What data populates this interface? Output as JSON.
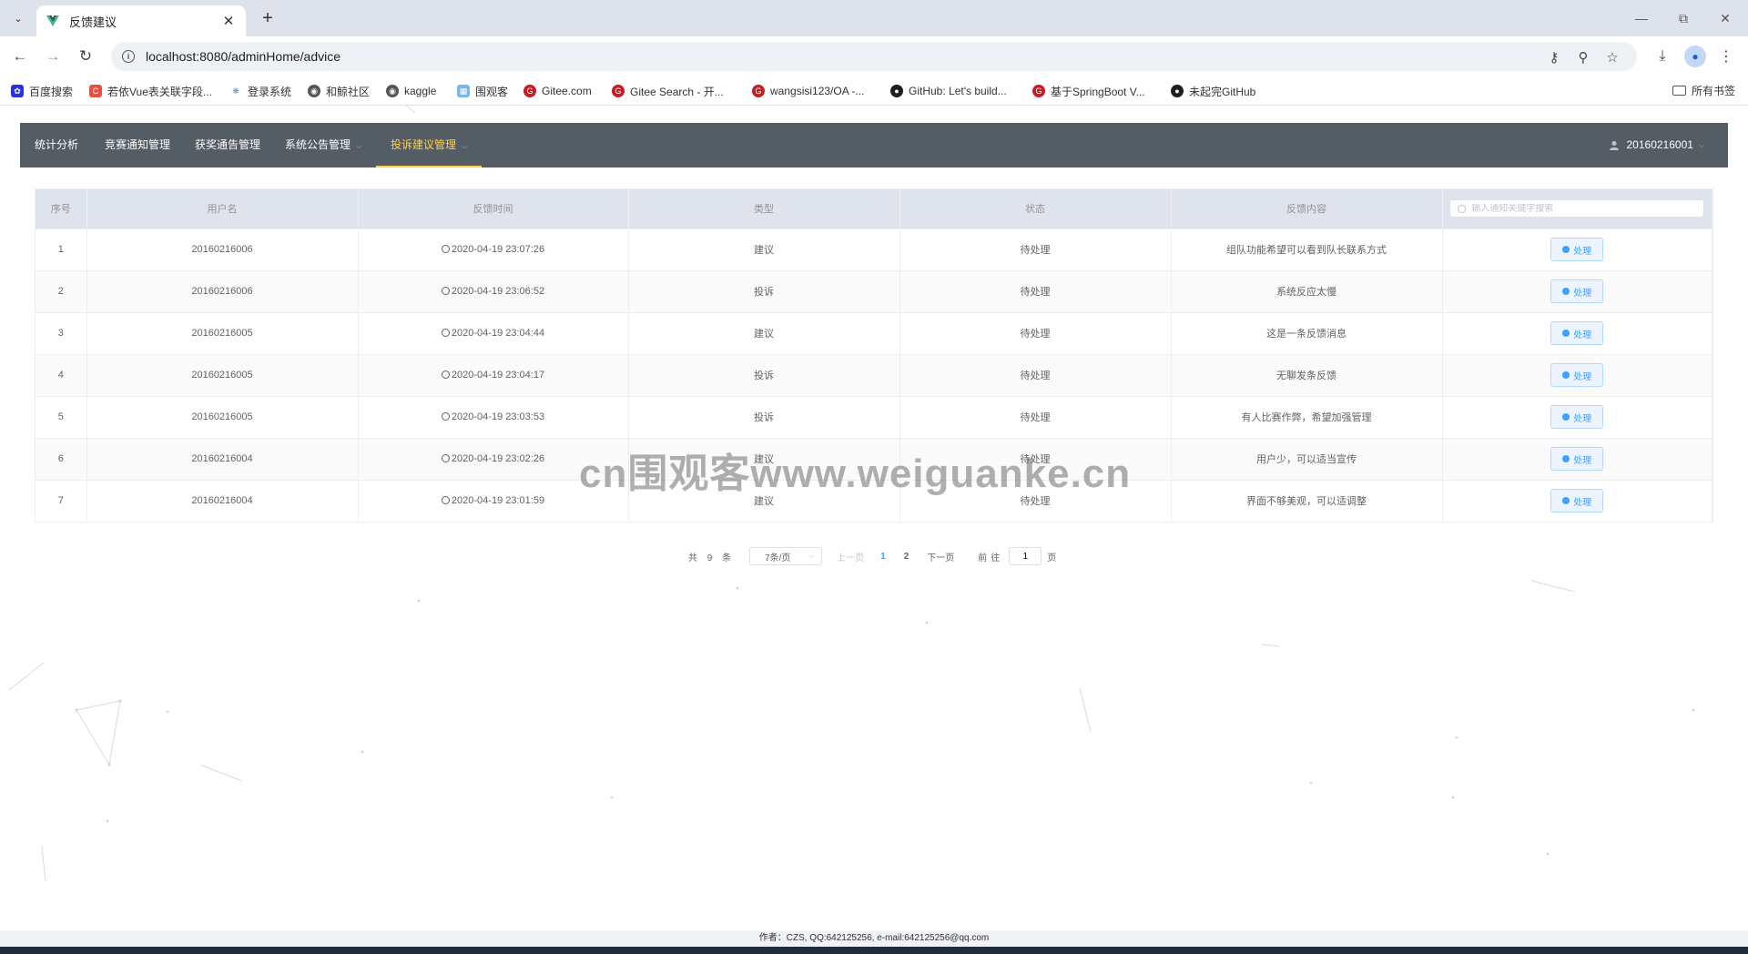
{
  "browser": {
    "tab_title": "反馈建议",
    "url": "localhost:8080/adminHome/advice",
    "bookmarks": [
      {
        "label": "百度搜索",
        "icon": "baidu-icon",
        "color": "#2932e1"
      },
      {
        "label": "若依Vue表关联字段...",
        "icon": "csdn-icon",
        "color": "#e84f3c"
      },
      {
        "label": "登录系统",
        "icon": "plant-icon",
        "color": "#4a90d9"
      },
      {
        "label": "和鲸社区",
        "icon": "globe-icon",
        "color": "#555555"
      },
      {
        "label": "kaggle",
        "icon": "globe-icon",
        "color": "#555555"
      },
      {
        "label": "围观客",
        "icon": "page-icon",
        "color": "#7ab6e8"
      },
      {
        "label": "Gitee.com",
        "icon": "gitee-icon",
        "color": "#c71d23"
      },
      {
        "label": "Gitee Search - 开...",
        "icon": "gitee-icon",
        "color": "#c71d23"
      },
      {
        "label": "wangsisi123/OA -...",
        "icon": "gitee-icon",
        "color": "#c71d23"
      },
      {
        "label": "GitHub: Let's build...",
        "icon": "github-icon",
        "color": "#1f1f1f"
      },
      {
        "label": "基于SpringBoot V...",
        "icon": "gitee-icon",
        "color": "#c71d23"
      },
      {
        "label": "未起完GitHub",
        "icon": "github-icon",
        "color": "#1f1f1f"
      }
    ],
    "all_bookmarks": "所有书签"
  },
  "nav": {
    "items": [
      {
        "label": "统计分析",
        "caret": false,
        "active": false
      },
      {
        "label": "竞赛通知管理",
        "caret": false,
        "active": false
      },
      {
        "label": "获奖通告管理",
        "caret": false,
        "active": false
      },
      {
        "label": "系统公告管理",
        "caret": true,
        "active": false
      },
      {
        "label": "投诉建议管理",
        "caret": true,
        "active": true
      }
    ],
    "user": "20160216001",
    "bg_color": "#545c64",
    "active_color": "#ffd04b"
  },
  "table": {
    "headers": [
      "序号",
      "用户名",
      "反馈时间",
      "类型",
      "状态",
      "反馈内容"
    ],
    "search_placeholder": "输入通知关键字搜索",
    "action_label": "处理",
    "rows": [
      {
        "index": "1",
        "username": "20160216006",
        "time": "2020-04-19 23:07:26",
        "type": "建议",
        "status": "待处理",
        "content": "组队功能希望可以看到队长联系方式"
      },
      {
        "index": "2",
        "username": "20160216006",
        "time": "2020-04-19 23:06:52",
        "type": "投诉",
        "status": "待处理",
        "content": "系统反应太慢"
      },
      {
        "index": "3",
        "username": "20160216005",
        "time": "2020-04-19 23:04:44",
        "type": "建议",
        "status": "待处理",
        "content": "这是一条反馈消息"
      },
      {
        "index": "4",
        "username": "20160216005",
        "time": "2020-04-19 23:04:17",
        "type": "投诉",
        "status": "待处理",
        "content": "无聊发条反馈"
      },
      {
        "index": "5",
        "username": "20160216005",
        "time": "2020-04-19 23:03:53",
        "type": "投诉",
        "status": "待处理",
        "content": "有人比赛作弊，希望加强管理"
      },
      {
        "index": "6",
        "username": "20160216004",
        "time": "2020-04-19 23:02:26",
        "type": "建议",
        "status": "待处理",
        "content": "用户少，可以适当宣传"
      },
      {
        "index": "7",
        "username": "20160216004",
        "time": "2020-04-19 23:01:59",
        "type": "建议",
        "status": "待处理",
        "content": "界面不够美观，可以适调整"
      }
    ]
  },
  "pagination": {
    "total": "共 9 条",
    "page_size": "7条/页",
    "prev": "上一页",
    "pages": [
      "1",
      "2"
    ],
    "current": "1",
    "next": "下一页",
    "goto_label": "前往",
    "goto_value": "1",
    "goto_suffix": "页"
  },
  "watermark": "cn围观客www.weiguanke.cn",
  "footer": "作者：CZS, QQ:642125256, e-mail:642125256@qq.com"
}
